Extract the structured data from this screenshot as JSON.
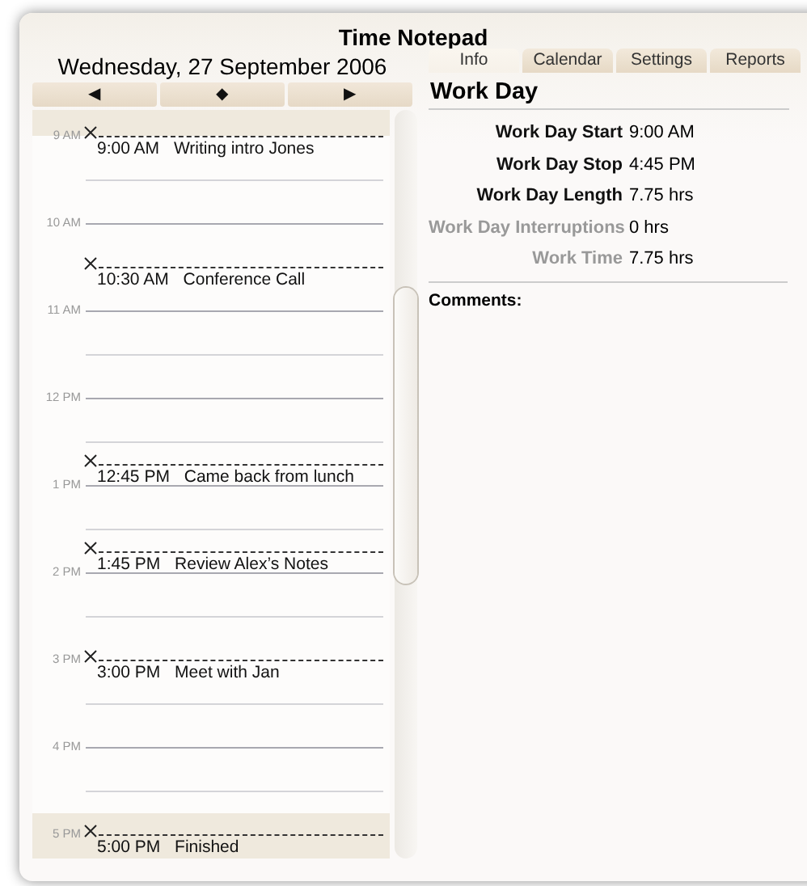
{
  "window": {
    "title": "Time Notepad"
  },
  "day": {
    "date": "Wednesday, 27 September 2006",
    "nav": [
      "◀",
      "◆",
      "▶"
    ]
  },
  "timeline": [
    {
      "kind": "event",
      "hour": "9 AM",
      "time": "9:00 AM",
      "title": "Writing intro Jones"
    },
    {
      "kind": "half"
    },
    {
      "kind": "hour",
      "hour": "10 AM"
    },
    {
      "kind": "event",
      "time": "10:30 AM",
      "title": "Conference Call"
    },
    {
      "kind": "hour",
      "hour": "11 AM"
    },
    {
      "kind": "half"
    },
    {
      "kind": "hour",
      "hour": "12 PM"
    },
    {
      "kind": "half"
    },
    {
      "kind": "event",
      "time": "12:45 PM",
      "title": "Came back from lunch"
    },
    {
      "kind": "hour",
      "hour": "1 PM"
    },
    {
      "kind": "half"
    },
    {
      "kind": "event",
      "time": "1:45 PM",
      "title": "Review Alex’s Notes"
    },
    {
      "kind": "hour",
      "hour": "2 PM"
    },
    {
      "kind": "half"
    },
    {
      "kind": "event",
      "hour": "3 PM",
      "time": "3:00 PM",
      "title": "Meet with Jan"
    },
    {
      "kind": "half"
    },
    {
      "kind": "hour",
      "hour": "4 PM"
    },
    {
      "kind": "half"
    },
    {
      "kind": "event",
      "hour": "5 PM",
      "time": "5:00 PM",
      "title": "Finished"
    }
  ],
  "tabs": [
    {
      "label": "Info",
      "selected": true
    },
    {
      "label": "Calendar",
      "selected": false
    },
    {
      "label": "Settings",
      "selected": false
    },
    {
      "label": "Reports",
      "selected": false
    }
  ],
  "info": {
    "heading": "Work Day",
    "fields": [
      {
        "label": "Work Day Start",
        "value": "9:00 AM",
        "disabled": false
      },
      {
        "label": "Work Day Stop",
        "value": "4:45 PM",
        "disabled": false
      },
      {
        "label": "Work Day Length",
        "value": "7.75 hrs",
        "disabled": false
      },
      {
        "label": "Work Day Interruptions",
        "value": "0 hrs",
        "disabled": true
      },
      {
        "label": "Work Time",
        "value": "7.75 hrs",
        "disabled": true
      }
    ],
    "comments_label": "Comments:"
  }
}
